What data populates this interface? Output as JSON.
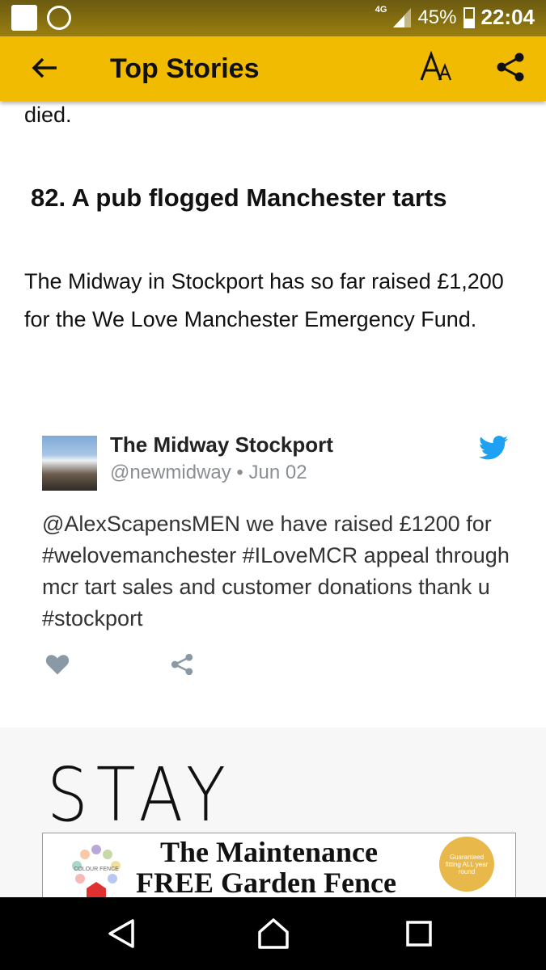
{
  "status_bar": {
    "network": "4G",
    "battery": "45%",
    "time": "22:04"
  },
  "app_bar": {
    "title": "Top Stories"
  },
  "article": {
    "partial_text": "died.",
    "heading": "82. A pub flogged Manchester tarts",
    "paragraph": "The Midway in Stockport has so far raised £1,200 for the We Love Manchester Emergency Fund."
  },
  "tweet": {
    "name": "The Midway Stockport",
    "handle": "@newmidway",
    "date": "Jun 02",
    "text": "@AlexScapensMEN we have raised £1200 for #welovemanchester #ILoveMCR appeal through mcr tart sales and customer donations thank u #stockport",
    "brand_color": "#1da1f2"
  },
  "image": {
    "caption": "STAY  STRONG"
  },
  "ad": {
    "logo_text": "COLOUR FENCE",
    "line1": "The Maintenance",
    "line2": "FREE Garden Fence",
    "badge": "Guaranteed fitting ALL year round"
  },
  "colors": {
    "app_bar": "#f0bb00",
    "status_bar": "#8a7310"
  }
}
